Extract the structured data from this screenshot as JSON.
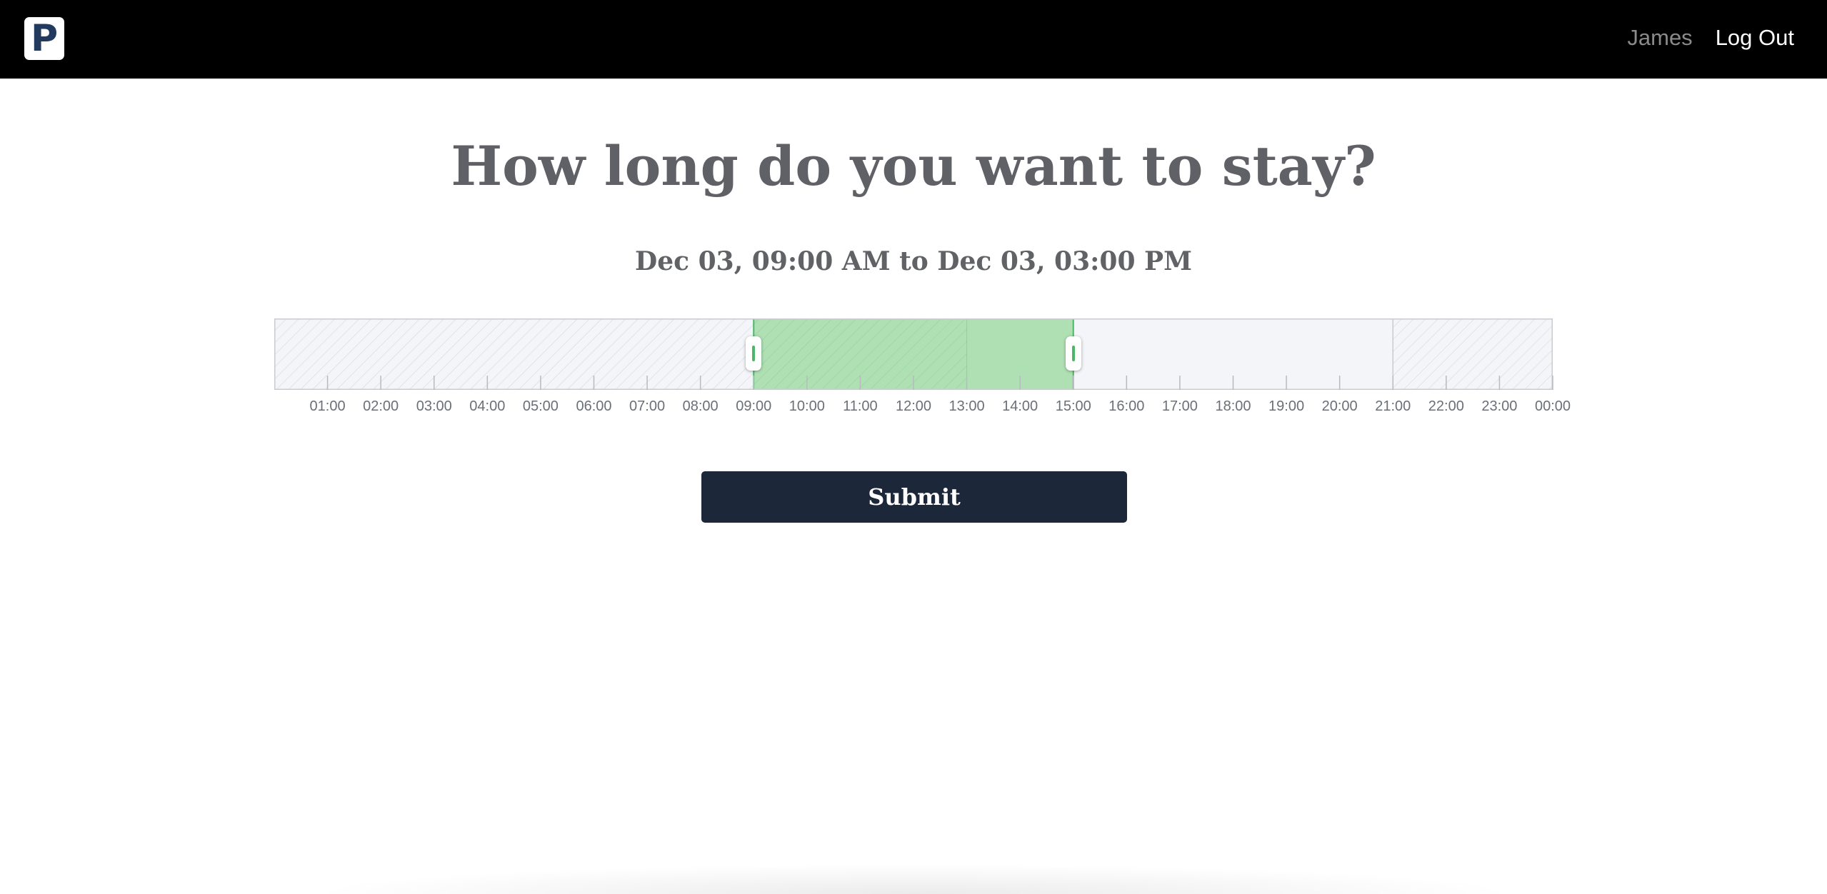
{
  "navbar": {
    "logo_letter": "P",
    "user_name": "James",
    "logout_label": "Log Out"
  },
  "main": {
    "title": "How long do you want to stay?",
    "range_text": "Dec 03, 09:00 AM to Dec 03, 03:00 PM",
    "submit_label": "Submit"
  },
  "timeline": {
    "hours": [
      "01:00",
      "02:00",
      "03:00",
      "04:00",
      "05:00",
      "06:00",
      "07:00",
      "08:00",
      "09:00",
      "10:00",
      "11:00",
      "12:00",
      "13:00",
      "14:00",
      "15:00",
      "16:00",
      "17:00",
      "18:00",
      "19:00",
      "20:00",
      "21:00",
      "22:00",
      "23:00",
      "00:00"
    ],
    "available_start_hour": 9,
    "available_end_hour": 21,
    "selected_start_hour": 9,
    "selected_end_hour": 15,
    "selection_color": "#afe0b3",
    "unavailable_color": "#f4f5f8",
    "handle_color": "#4cb866"
  }
}
